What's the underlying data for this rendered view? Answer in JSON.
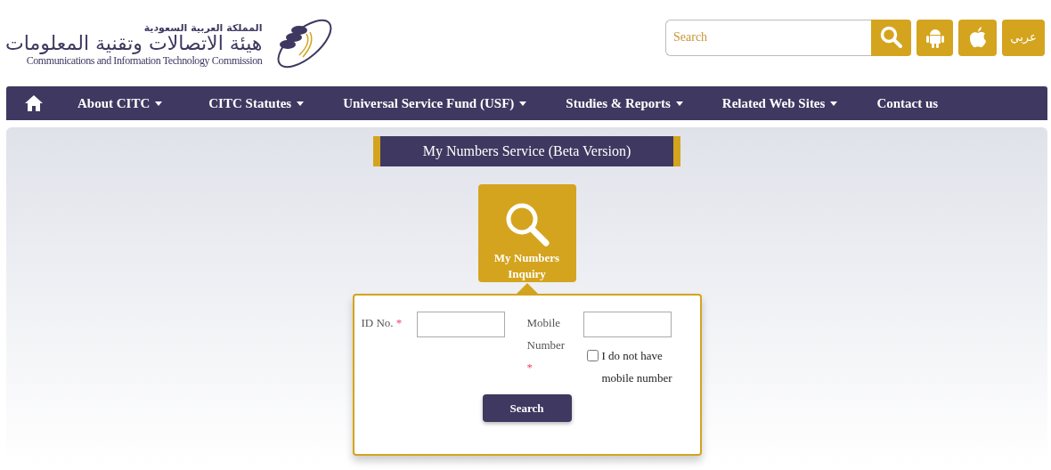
{
  "header": {
    "logo": {
      "arabic_line_1": "المملكة العربية السعودية",
      "arabic_line_2": "هيئة الاتصالات وتقنية المعلومات",
      "english": "Communications and Information Technology Commission"
    },
    "search": {
      "placeholder": "Search"
    },
    "language_button": "عربي"
  },
  "nav": {
    "items": [
      {
        "label": "About CITC",
        "dropdown": true
      },
      {
        "label": "CITC Statutes",
        "dropdown": true
      },
      {
        "label": "Universal Service Fund (USF)",
        "dropdown": true
      },
      {
        "label": "Studies & Reports",
        "dropdown": true
      },
      {
        "label": "Related Web Sites",
        "dropdown": true
      },
      {
        "label": "Contact us",
        "dropdown": false
      }
    ]
  },
  "service_title": "My Numbers Service (Beta Version)",
  "tile": {
    "label": "My Numbers Inquiry"
  },
  "form": {
    "fields": [
      {
        "label": "ID No.",
        "required_mark": "*"
      },
      {
        "label": "Mobile Number",
        "required_mark": "*"
      }
    ],
    "no_mobile": {
      "label": "I do not have mobile number",
      "checked": false
    },
    "button": "Search"
  }
}
